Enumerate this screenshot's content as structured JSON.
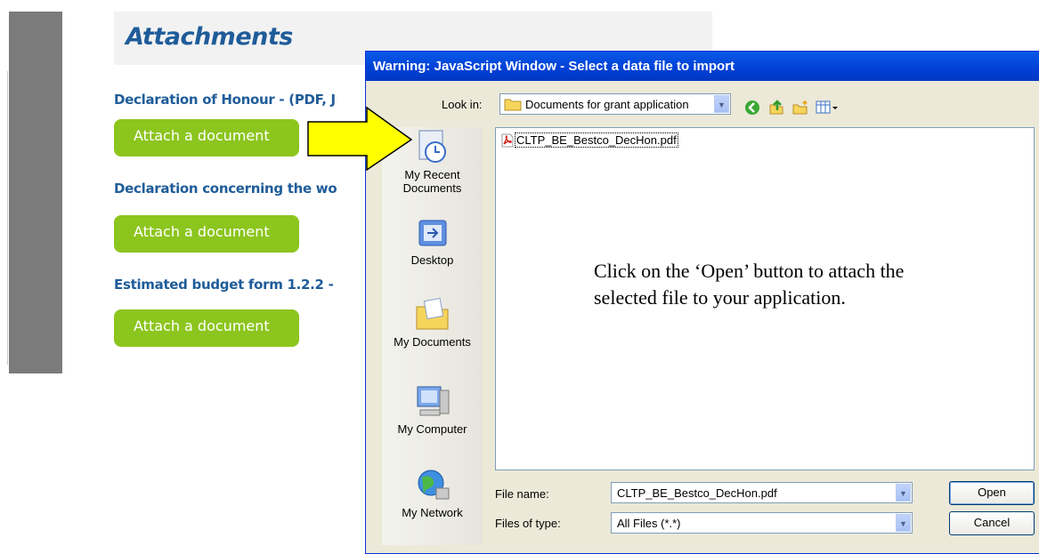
{
  "page": {
    "attachments_title": "Attachments",
    "sections": [
      {
        "label": "Declaration of Honour - (PDF, J",
        "button": "Attach a document"
      },
      {
        "label": "Declaration concerning the wo",
        "button": "Attach a document"
      },
      {
        "label": "Estimated budget form 1.2.2 -",
        "button": "Attach a document"
      }
    ]
  },
  "dialog": {
    "title": "Warning: JavaScript Window - Select a data file to import",
    "look_in_label": "Look in:",
    "look_in_value": "Documents for grant application",
    "places": [
      {
        "label": "My Recent\nDocuments",
        "icon": "recent-documents-icon"
      },
      {
        "label": "Desktop",
        "icon": "desktop-icon"
      },
      {
        "label": "My Documents",
        "icon": "my-documents-icon"
      },
      {
        "label": "My Computer",
        "icon": "my-computer-icon"
      },
      {
        "label": "My Network",
        "icon": "my-network-icon"
      }
    ],
    "files": [
      {
        "name": "CLTP_BE_Bestco_DecHon.pdf",
        "icon": "pdf-file-icon"
      }
    ],
    "instruction": "Click on the ‘Open’ button to attach the selected file to your application.",
    "file_name_label": "File name:",
    "file_name_value": "CLTP_BE_Bestco_DecHon.pdf",
    "file_type_label": "Files of type:",
    "file_type_value": "All Files (*.*)",
    "open_button": "Open",
    "cancel_button": "Cancel"
  },
  "colors": {
    "accent_button": "#8cc51e",
    "heading": "#1f5c99",
    "titlebar": "#0a5ae8",
    "arrow": "#ffff00"
  }
}
